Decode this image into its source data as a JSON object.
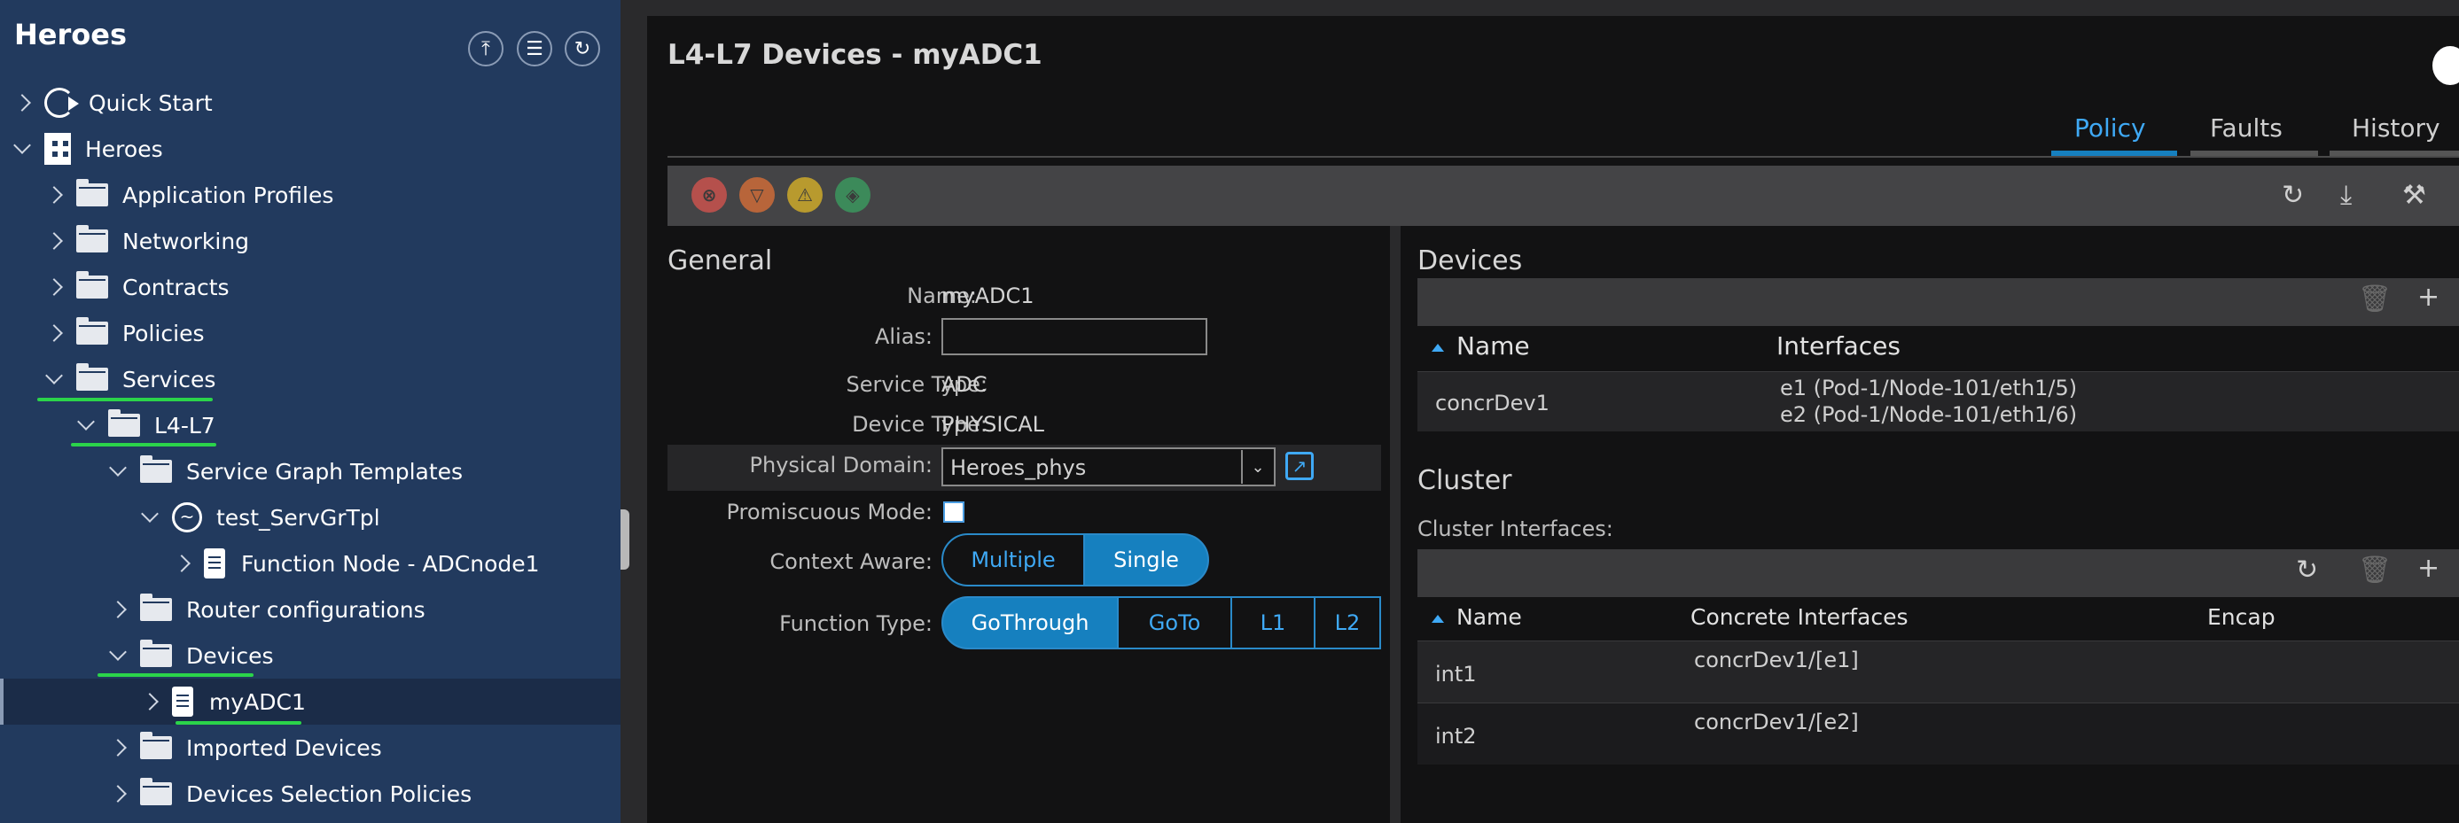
{
  "sidebar": {
    "title": "Heroes",
    "tree": [
      {
        "label": "Quick Start"
      },
      {
        "label": "Heroes"
      },
      {
        "label": "Application Profiles"
      },
      {
        "label": "Networking"
      },
      {
        "label": "Contracts"
      },
      {
        "label": "Policies"
      },
      {
        "label": "Services"
      },
      {
        "label": "L4-L7"
      },
      {
        "label": "Service Graph Templates"
      },
      {
        "label": "test_ServGrTpl"
      },
      {
        "label": "Function Node - ADCnode1"
      },
      {
        "label": "Router configurations"
      },
      {
        "label": "Devices"
      },
      {
        "label": "myADC1"
      },
      {
        "label": "Imported Devices"
      },
      {
        "label": "Devices Selection Policies"
      }
    ]
  },
  "main": {
    "title": "L4-L7 Devices - myADC1",
    "tabs": [
      {
        "label": "Policy",
        "active": true
      },
      {
        "label": "Faults"
      },
      {
        "label": "History"
      }
    ],
    "fault_icons": [
      {
        "name": "critical",
        "color": "#d9534f",
        "glyph": "⊗"
      },
      {
        "name": "major",
        "color": "#e07b39",
        "glyph": "▽"
      },
      {
        "name": "minor",
        "color": "#e7c23a",
        "glyph": "⚠"
      },
      {
        "name": "warning",
        "color": "#3fb56b",
        "glyph": "◈"
      }
    ],
    "general": {
      "heading": "General",
      "name_label": "Name:",
      "name_value": "myADC1",
      "alias_label": "Alias:",
      "alias_value": "",
      "service_type_label": "Service Type:",
      "service_type_value": "ADC",
      "device_type_label": "Device Type:",
      "device_type_value": "PHYSICAL",
      "physical_domain_label": "Physical Domain:",
      "physical_domain_value": "Heroes_phys",
      "promiscuous_label": "Promiscuous Mode:",
      "context_aware_label": "Context Aware:",
      "context_aware_options": [
        "Multiple",
        "Single"
      ],
      "context_aware_selected": "Single",
      "function_type_label": "Function Type:",
      "function_type_options": [
        "GoThrough",
        "GoTo",
        "L1",
        "L2"
      ],
      "function_type_selected": "GoThrough"
    },
    "devices": {
      "heading": "Devices",
      "col_name": "Name",
      "col_interfaces": "Interfaces",
      "rows": [
        {
          "name": "concrDev1",
          "if1": "e1 (Pod-1/Node-101/eth1/5)",
          "if2": "e2 (Pod-1/Node-101/eth1/6)"
        }
      ]
    },
    "cluster": {
      "heading": "Cluster",
      "interfaces_label": "Cluster Interfaces:",
      "col_name": "Name",
      "col_concrete": "Concrete Interfaces",
      "col_encap": "Encap",
      "rows": [
        {
          "name": "int1",
          "concrete": "concrDev1/[e1]",
          "encap": ""
        },
        {
          "name": "int2",
          "concrete": "concrDev1/[e2]",
          "encap": ""
        }
      ]
    }
  }
}
